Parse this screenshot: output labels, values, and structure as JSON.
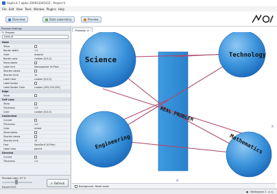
{
  "window": {
    "title": "Gephi 0.7 alpha 200912041022 - Project 0"
  },
  "menu": [
    "File",
    "Edit",
    "View",
    "Tools",
    "Window",
    "Plugins",
    "Help"
  ],
  "tabs": [
    {
      "label": "Overview",
      "icon": "overview-icon",
      "color": "#4a7fcf"
    },
    {
      "label": "Data Laboratory",
      "icon": "table-icon",
      "color": "#6aa84f"
    },
    {
      "label": "Preview",
      "icon": "preview-icon",
      "color": "#d08a2e"
    }
  ],
  "left_panel": {
    "title": "Preview Settings",
    "presets_label": "Presets",
    "preset_value": "Default",
    "rows": [
      {
        "type": "section",
        "label": "Node"
      },
      {
        "label": "Show",
        "value": "",
        "check": true
      },
      {
        "label": "Border width",
        "value": "1.0"
      },
      {
        "label": "Color",
        "value": "original"
      },
      {
        "label": "Border color",
        "value": "custom [0,0,0]"
      },
      {
        "label": "Show labels",
        "value": "",
        "check": true
      },
      {
        "label": "Label font",
        "value": "Monospaced 16 Plain"
      },
      {
        "label": "Shorten labels",
        "value": "",
        "check": true
      },
      {
        "label": "Shorten limit",
        "value": "10"
      },
      {
        "label": "Label color",
        "value": "custom [0,0,0]"
      },
      {
        "label": "Label border",
        "value": "",
        "check": true
      },
      {
        "label": "Label Border Color",
        "value": "custom [255,255,255]"
      },
      {
        "type": "section",
        "label": "Edge"
      },
      {
        "label": "Show",
        "value": "",
        "check": true
      },
      {
        "type": "section",
        "label": "Self Loop"
      },
      {
        "label": "Show",
        "value": "",
        "check": true
      },
      {
        "label": "Thickness",
        "value": "1.0"
      },
      {
        "label": "Color",
        "value": "custom [0,0,0]"
      },
      {
        "type": "section",
        "label": "Undirected"
      },
      {
        "label": "Curved",
        "value": "",
        "check": true
      },
      {
        "label": "Thickness",
        "value": "1.0"
      },
      {
        "label": "Color",
        "value": "mixed"
      },
      {
        "label": "Show labels",
        "value": "",
        "check": true
      },
      {
        "label": "Shorten labels",
        "value": "",
        "check": true
      },
      {
        "label": "Shorten limit",
        "value": "10"
      },
      {
        "label": "Font",
        "value": "SansSerif 10 Plain"
      },
      {
        "label": "Label color",
        "value": "parent"
      },
      {
        "type": "section",
        "label": "Directed"
      },
      {
        "label": "Curved",
        "value": "",
        "check": true
      },
      {
        "label": "Thickness",
        "value": "1.0"
      }
    ],
    "preview_ratio_label": "Preview ratio: 47 %",
    "preview_ratio": 0.47,
    "export_label": "Export:",
    "export_value": "SVG",
    "refresh_label": "Refresh"
  },
  "preview_tab_label": "Preview",
  "bottom_bar": {
    "background_label": "Background",
    "reset_zoom_label": "Reset zoom"
  },
  "status": {
    "workspace_label": "Workspace 1"
  },
  "graph": {
    "nodes": [
      {
        "id": "science",
        "label": "Science",
        "color": "#2c8ad6"
      },
      {
        "id": "technology",
        "label": "Technology",
        "color": "#2c8ad6"
      },
      {
        "id": "engineering",
        "label": "Engineering",
        "color": "#2c8ad6"
      },
      {
        "id": "mathematics",
        "label": "Mathematics",
        "color": "#2c8ad6"
      }
    ],
    "center_label": "REAL PROBLEM",
    "edge_color": "#b04a6a"
  }
}
